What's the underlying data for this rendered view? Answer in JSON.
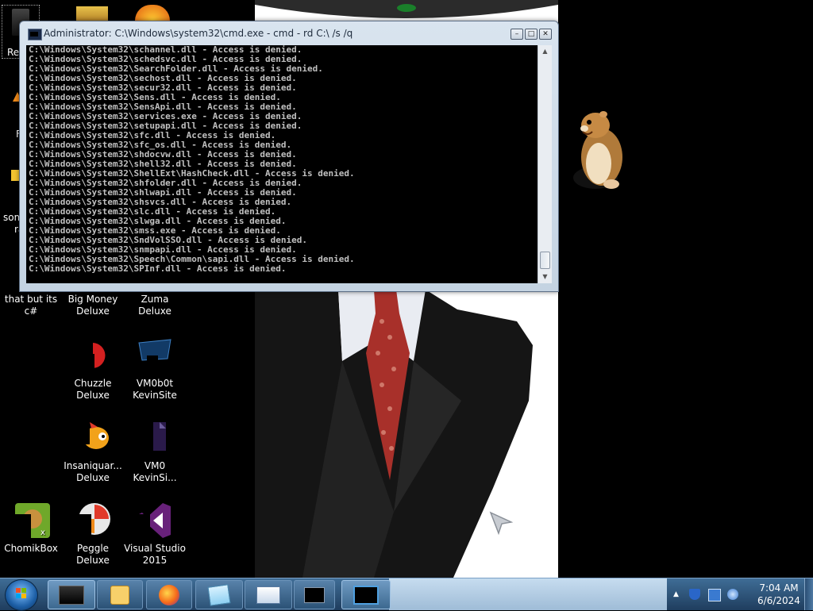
{
  "desktop": {
    "partial_labels": {
      "recycle": "Re",
      "some_left": "som",
      "ra": "ra",
      "f_letter": "F"
    },
    "icons": [
      {
        "label": "that but its c#"
      },
      {
        "label": "Big Money Deluxe"
      },
      {
        "label": "Zuma Deluxe"
      },
      {
        "label": "Chuzzle Deluxe"
      },
      {
        "label": "VM0b0t KevinSite"
      },
      {
        "label": "Insaniquar... Deluxe"
      },
      {
        "label": "VM0 KevinSi..."
      },
      {
        "label": "ChomikBox"
      },
      {
        "label": "Peggle Deluxe"
      },
      {
        "label": "Visual Studio 2015"
      }
    ]
  },
  "cmd": {
    "title": "Administrator: C:\\Windows\\system32\\cmd.exe - cmd - rd  C:\\ /s /q",
    "lines": [
      "C:\\Windows\\System32\\schannel.dll - Access is denied.",
      "C:\\Windows\\System32\\schedsvc.dll - Access is denied.",
      "C:\\Windows\\System32\\SearchFolder.dll - Access is denied.",
      "C:\\Windows\\System32\\sechost.dll - Access is denied.",
      "C:\\Windows\\System32\\secur32.dll - Access is denied.",
      "C:\\Windows\\System32\\Sens.dll - Access is denied.",
      "C:\\Windows\\System32\\SensApi.dll - Access is denied.",
      "C:\\Windows\\System32\\services.exe - Access is denied.",
      "C:\\Windows\\System32\\setupapi.dll - Access is denied.",
      "C:\\Windows\\System32\\sfc.dll - Access is denied.",
      "C:\\Windows\\System32\\sfc_os.dll - Access is denied.",
      "C:\\Windows\\System32\\shdocvw.dll - Access is denied.",
      "C:\\Windows\\System32\\shell32.dll - Access is denied.",
      "C:\\Windows\\System32\\ShellExt\\HashCheck.dll - Access is denied.",
      "C:\\Windows\\System32\\shfolder.dll - Access is denied.",
      "C:\\Windows\\System32\\shlwapi.dll - Access is denied.",
      "C:\\Windows\\System32\\shsvcs.dll - Access is denied.",
      "C:\\Windows\\System32\\slc.dll - Access is denied.",
      "C:\\Windows\\System32\\slwga.dll - Access is denied.",
      "C:\\Windows\\System32\\smss.exe - Access is denied.",
      "C:\\Windows\\System32\\SndVolSSO.dll - Access is denied.",
      "C:\\Windows\\System32\\snmpapi.dll - Access is denied.",
      "C:\\Windows\\System32\\Speech\\Common\\sapi.dll - Access is denied.",
      "C:\\Windows\\System32\\SPInf.dll - Access is denied."
    ]
  },
  "taskbar": {
    "start_partial_text": "Start",
    "clock_time": "7:04 AM",
    "clock_date": "6/6/2024"
  },
  "colors": {
    "console_text": "#c0c0c0",
    "console_bg": "#000000",
    "taskbar": "#2b5276"
  }
}
